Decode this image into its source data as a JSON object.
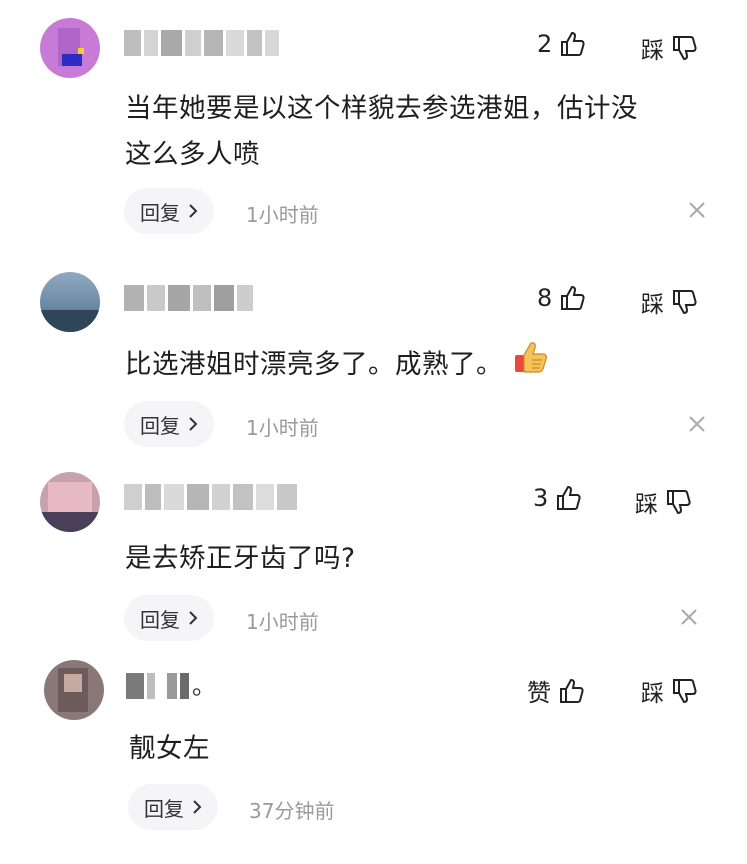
{
  "comments": [
    {
      "like_count": "2",
      "dislike_label": "踩",
      "text_lines": [
        "当年她要是以这个样貌去参选港姐，估计没",
        "这么多人喷"
      ],
      "reply_label": "回复",
      "time": "1小时前",
      "emoji": ""
    },
    {
      "like_count": "8",
      "dislike_label": "踩",
      "text_lines": [
        "比选港姐时漂亮多了。成熟了。"
      ],
      "reply_label": "回复",
      "time": "1小时前",
      "emoji": "thumbs-up-emoji"
    },
    {
      "like_count": "3",
      "dislike_label": "踩",
      "text_lines": [
        "是去矫正牙齿了吗?"
      ],
      "reply_label": "回复",
      "time": "1小时前",
      "emoji": ""
    },
    {
      "username_suffix": "。",
      "like_count": "赞",
      "dislike_label": "踩",
      "text_lines": [
        "靓女左"
      ],
      "reply_label": "回复",
      "time": "37分钟前",
      "emoji": ""
    }
  ],
  "colors": {
    "avatar1": "#c77bd6",
    "avatar2": "#6f8ea8",
    "avatar3": "#b98a9a",
    "avatar4": "#7a6a6a",
    "reply_bg": "#f5f5f7",
    "time": "#9a9a9a"
  },
  "icons": [
    "thumbs-up-icon",
    "thumbs-down-icon",
    "chevron-right-icon",
    "close-icon"
  ]
}
